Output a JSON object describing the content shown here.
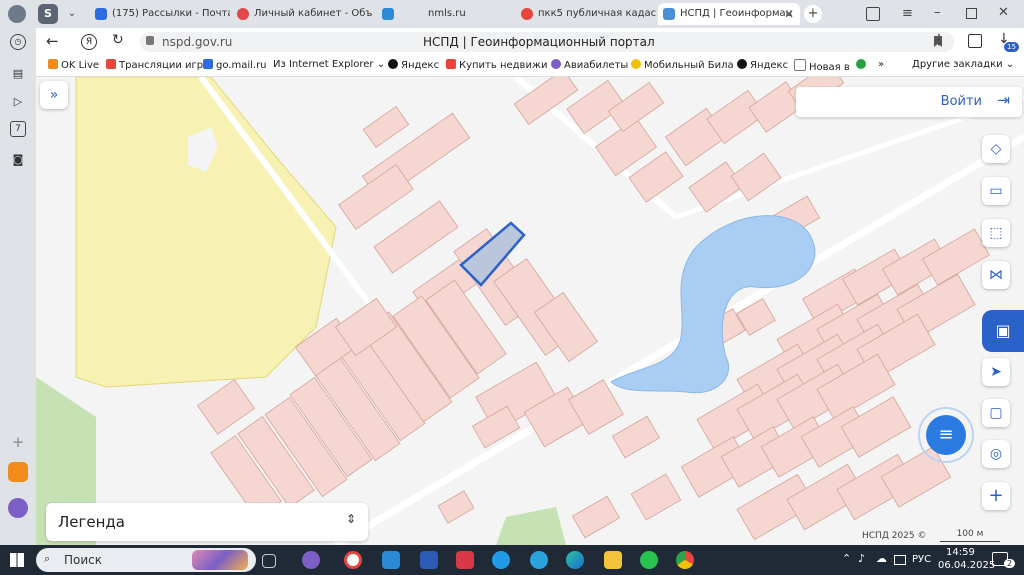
{
  "tabs": [
    {
      "label": "",
      "icon": "shield-icon",
      "color": "#6c7a89"
    },
    {
      "label": "",
      "icon": "app-s-icon",
      "color": "#5b6573"
    },
    {
      "label": "(175) Рассылки - Почта",
      "icon": "mail-icon",
      "color": "#2b6de0"
    },
    {
      "label": "Личный кабинет - Объ",
      "icon": "cabinet-icon",
      "color": "#e2484a"
    },
    {
      "label": "nmls.ru",
      "icon": "nmls-icon",
      "color": "#2a8bd8"
    },
    {
      "label": "пкк5 публичная кадаст",
      "icon": "yandex-icon",
      "color": "#e8453c"
    },
    {
      "label": "НСПД | Геоинформац",
      "icon": "nspd-icon",
      "color": "#4a90d9"
    }
  ],
  "address": {
    "url": "nspd.gov.ru",
    "page_title": "НСПД | Геоинформационный портал",
    "downloads_badge": "15"
  },
  "bookmarks": [
    {
      "label": "OK Live",
      "color": "#f38b1c"
    },
    {
      "label": "Трансляции игр",
      "color": "#e8453c"
    },
    {
      "label": "go.mail.ru",
      "color": "#2b6de0"
    },
    {
      "label": "Из Internet Explorer",
      "color": ""
    },
    {
      "label": "Яндекс",
      "color": "#111111"
    },
    {
      "label": "Купить недвижи",
      "color": "#e8453c"
    },
    {
      "label": "Авиабилеты",
      "color": "#7b5fc7"
    },
    {
      "label": "Мобильный Била",
      "color": "#f2c200"
    },
    {
      "label": "Яндекс",
      "color": "#111111"
    },
    {
      "label": "Новая в",
      "color": "#777777"
    },
    {
      "label": "",
      "color": "#27a243"
    }
  ],
  "bookmarks_more": "»",
  "other_bookmarks": "Другие закладки",
  "map": {
    "login_label": "Войти",
    "legend_label": "Легенда",
    "copyright": "НСПД 2025 ©",
    "scale_label": "100 м",
    "colors": {
      "parcel_fill": "#f6d6d0",
      "parcel_stroke": "#d5a39a",
      "field_fill": "#f7f2b3",
      "water_fill": "#a9cdf3",
      "forest_fill": "#c6e1b4",
      "selected_stroke": "#2a62c9"
    }
  },
  "taskbar": {
    "search_placeholder": "Поиск",
    "language": "РУС",
    "time": "14:59",
    "date": "06.04.2025",
    "notifications": "2"
  }
}
